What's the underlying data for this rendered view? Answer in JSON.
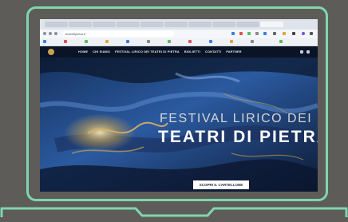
{
  "browser": {
    "tabs": [
      "",
      "",
      "",
      "",
      "",
      "",
      "",
      "",
      "",
      ""
    ],
    "url": "teatridipietra.it",
    "bookmarks": [
      "",
      "",
      "",
      "",
      "",
      "",
      "",
      "",
      "",
      "",
      "",
      ""
    ]
  },
  "site": {
    "menu": [
      "HOME",
      "CHI SIAMO",
      "FESTIVAL LIRICO DEI TEATRI DI PIETRA",
      "BIGLIETTI",
      "CONTATTI",
      "PARTNER"
    ],
    "hero_line1": "FESTIVAL LIRICO DEI",
    "hero_line2": "TEATRI DI PIETRA",
    "hero_note": "",
    "hero_button": "SCOPRI IL CARTELLONE"
  },
  "colors": {
    "background": "#5e5c58",
    "outline": "#7fd6b0",
    "hero_deep": "#0d1e3a",
    "hero_blue": "#2f5fa8",
    "gold": "#c9a24e"
  }
}
